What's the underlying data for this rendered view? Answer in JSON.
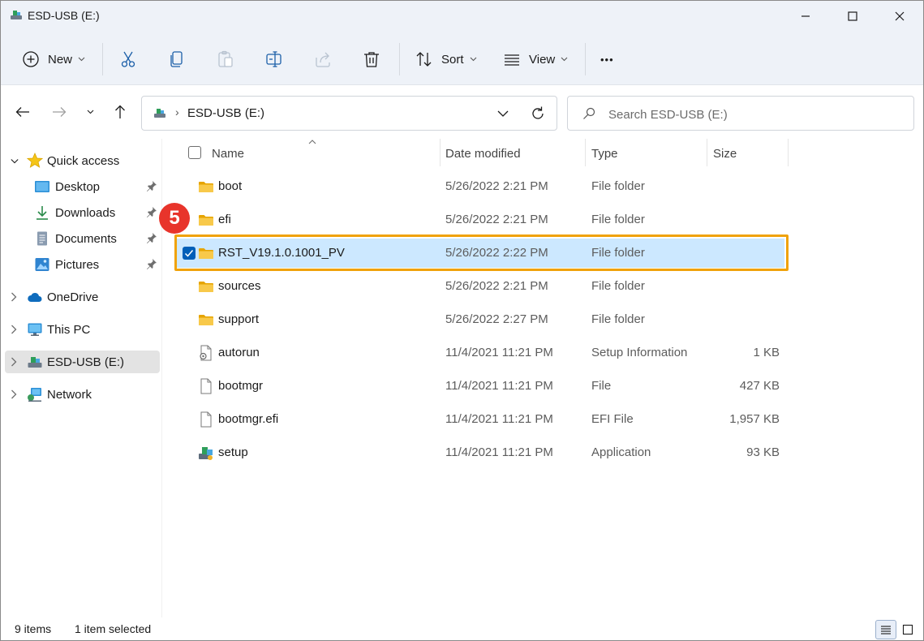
{
  "window": {
    "title": "ESD-USB (E:)"
  },
  "toolbar": {
    "new_label": "New",
    "sort_label": "Sort",
    "view_label": "View",
    "more_label": "•••"
  },
  "nav": {
    "address_separator": "›",
    "address_text": "ESD-USB (E:)",
    "search_placeholder": "Search ESD-USB (E:)"
  },
  "sidebar": {
    "items": [
      {
        "label": "Quick access",
        "icon": "star-icon"
      },
      {
        "label": "Desktop",
        "icon": "desktop-icon",
        "pinned": true
      },
      {
        "label": "Downloads",
        "icon": "download-icon",
        "pinned": true
      },
      {
        "label": "Documents",
        "icon": "document-icon",
        "pinned": true
      },
      {
        "label": "Pictures",
        "icon": "picture-icon",
        "pinned": true
      },
      {
        "label": "OneDrive",
        "icon": "cloud-icon"
      },
      {
        "label": "This PC",
        "icon": "monitor-icon"
      },
      {
        "label": "ESD-USB (E:)",
        "icon": "usb-drive-icon",
        "selected": true
      },
      {
        "label": "Network",
        "icon": "network-icon"
      }
    ]
  },
  "columns": {
    "name": "Name",
    "date": "Date modified",
    "type": "Type",
    "size": "Size"
  },
  "files": [
    {
      "name": "boot",
      "date": "5/26/2022 2:21 PM",
      "type": "File folder",
      "size": "",
      "icon": "folder-icon"
    },
    {
      "name": "efi",
      "date": "5/26/2022 2:21 PM",
      "type": "File folder",
      "size": "",
      "icon": "folder-icon"
    },
    {
      "name": "RST_V19.1.0.1001_PV",
      "date": "5/26/2022 2:22 PM",
      "type": "File folder",
      "size": "",
      "icon": "folder-icon",
      "selected": true
    },
    {
      "name": "sources",
      "date": "5/26/2022 2:21 PM",
      "type": "File folder",
      "size": "",
      "icon": "folder-icon"
    },
    {
      "name": "support",
      "date": "5/26/2022 2:27 PM",
      "type": "File folder",
      "size": "",
      "icon": "folder-icon"
    },
    {
      "name": "autorun",
      "date": "11/4/2021 11:21 PM",
      "type": "Setup Information",
      "size": "1 KB",
      "icon": "settings-file-icon"
    },
    {
      "name": "bootmgr",
      "date": "11/4/2021 11:21 PM",
      "type": "File",
      "size": "427 KB",
      "icon": "file-icon"
    },
    {
      "name": "bootmgr.efi",
      "date": "11/4/2021 11:21 PM",
      "type": "EFI File",
      "size": "1,957 KB",
      "icon": "file-icon"
    },
    {
      "name": "setup",
      "date": "11/4/2021 11:21 PM",
      "type": "Application",
      "size": "93 KB",
      "icon": "setup-app-icon"
    }
  ],
  "annotation": {
    "step_number": "5",
    "highlight_color": "#f0a20a",
    "badge_color": "#e8342b"
  },
  "status": {
    "item_count": "9 items",
    "selection": "1 item selected"
  },
  "colors": {
    "selection": "#cce8ff",
    "accent": "#005fb8",
    "folder": "#f8c94a"
  }
}
